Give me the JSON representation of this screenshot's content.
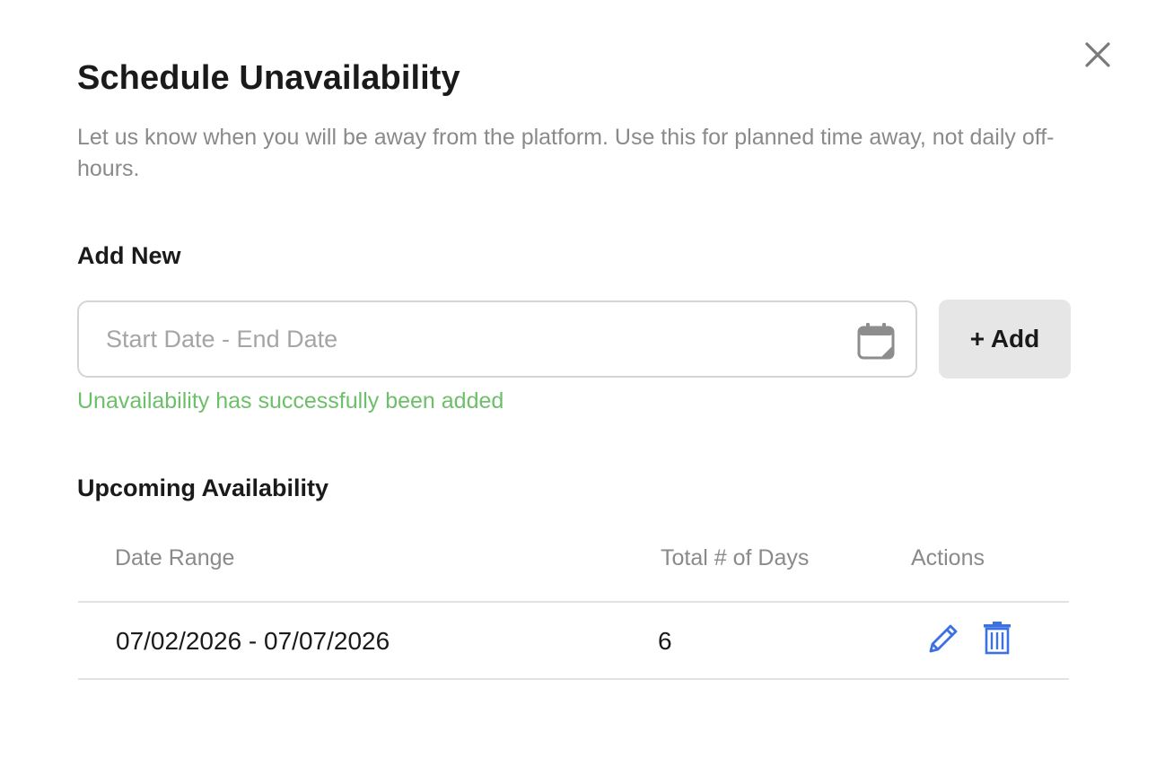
{
  "modal": {
    "title": "Schedule Unavailability",
    "subtitle": "Let us know when you will be away from the platform. Use this for planned time away, not daily off-hours.",
    "close_icon": "close-icon"
  },
  "add_new": {
    "label": "Add New",
    "date_input": {
      "placeholder": "Start Date - End Date",
      "value": "",
      "icon": "calendar-icon"
    },
    "add_button_label": "+ Add",
    "success_message": "Unavailability has successfully been added"
  },
  "upcoming": {
    "label": "Upcoming Availability",
    "columns": [
      "Date Range",
      "Total # of Days",
      "Actions"
    ],
    "rows": [
      {
        "date_range": "07/02/2026 - 07/07/2026",
        "total_days": "6",
        "actions": [
          "pencil-icon",
          "trash-icon"
        ]
      }
    ]
  },
  "colors": {
    "success": "#6dbf6a",
    "action_icon": "#3b72e0",
    "add_button_bg": "#e6e6e6",
    "muted_text": "#8a8a8a"
  }
}
